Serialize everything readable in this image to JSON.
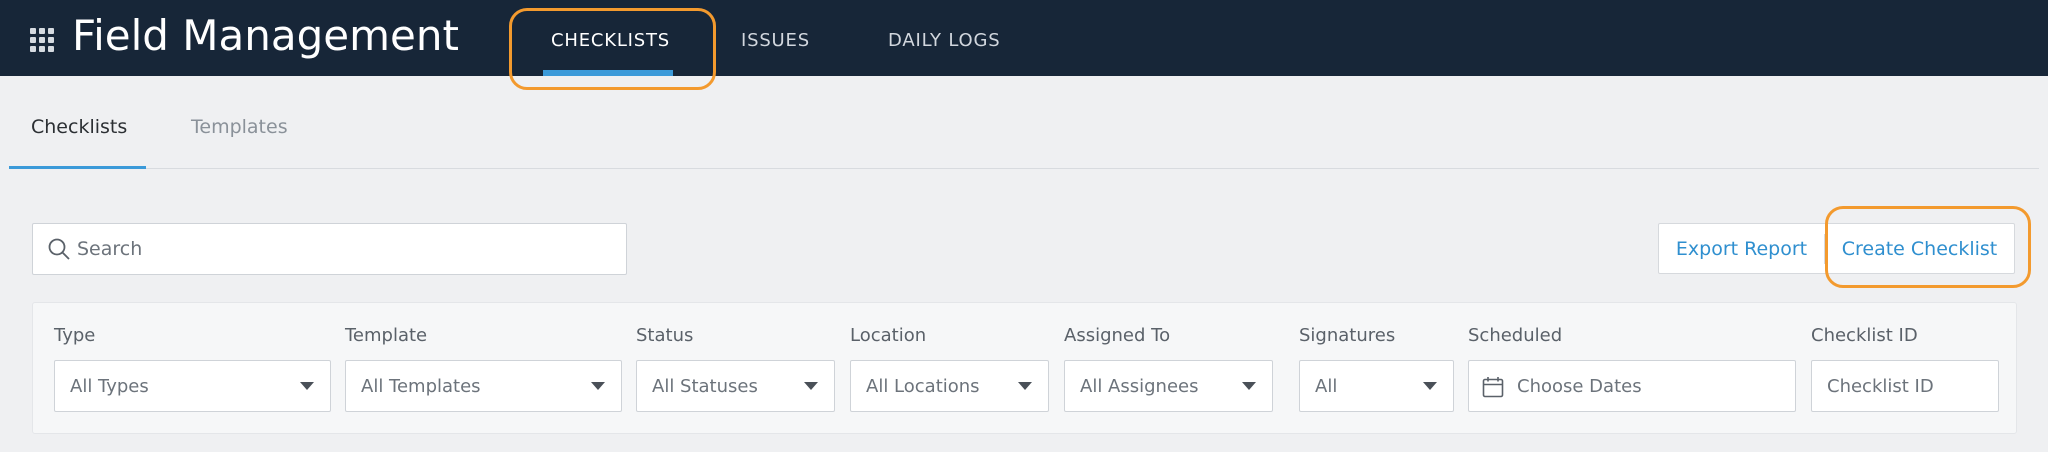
{
  "app": {
    "title": "Field Management"
  },
  "top_tabs": [
    {
      "label": "CHECKLISTS",
      "active": true
    },
    {
      "label": "ISSUES",
      "active": false
    },
    {
      "label": "DAILY LOGS",
      "active": false
    }
  ],
  "sub_tabs": [
    {
      "label": "Checklists",
      "active": true
    },
    {
      "label": "Templates",
      "active": false
    }
  ],
  "search": {
    "placeholder": "Search"
  },
  "actions": {
    "export_label": "Export Report",
    "create_label": "Create Checklist"
  },
  "filters": [
    {
      "label": "Type",
      "value": "All Types",
      "kind": "select"
    },
    {
      "label": "Template",
      "value": "All Templates",
      "kind": "select"
    },
    {
      "label": "Status",
      "value": "All Statuses",
      "kind": "select"
    },
    {
      "label": "Location",
      "value": "All Locations",
      "kind": "select"
    },
    {
      "label": "Assigned To",
      "value": "All Assignees",
      "kind": "select"
    },
    {
      "label": "Signatures",
      "value": "All",
      "kind": "select"
    },
    {
      "label": "Scheduled",
      "value": "Choose Dates",
      "kind": "date"
    },
    {
      "label": "Checklist ID",
      "value": "Checklist ID",
      "kind": "text"
    }
  ],
  "colors": {
    "topbar": "#172638",
    "accent": "#3b9ad9",
    "highlight": "#f39a2e",
    "link": "#2f8fcf"
  },
  "icons": {
    "apps": "grid-icon",
    "search": "search-icon",
    "calendar": "calendar-icon",
    "dropdown": "caret-down-icon"
  }
}
